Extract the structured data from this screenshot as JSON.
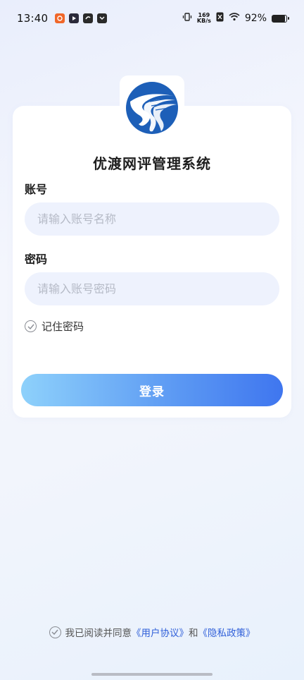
{
  "status_bar": {
    "time": "13:40",
    "net_speed_value": "169",
    "net_speed_unit": "KB/s",
    "battery_percent": "92%",
    "battery_level": 0.92
  },
  "app": {
    "title": "优渡网评管理系统",
    "logo_icon": "app-logo-icon"
  },
  "form": {
    "account_label": "账号",
    "account_placeholder": "请输入账号名称",
    "password_label": "密码",
    "password_placeholder": "请输入账号密码",
    "remember_label": "记住密码",
    "login_label": "登录"
  },
  "agreement": {
    "prefix": "我已阅读并同意",
    "user_agreement": "《用户协议》",
    "and": "和",
    "privacy_policy": "《隐私政策》"
  },
  "colors": {
    "accent_start": "#8ed1fb",
    "accent_end": "#3f76ef",
    "link": "#2f5fd9",
    "logo_blue": "#1d5fb8"
  }
}
